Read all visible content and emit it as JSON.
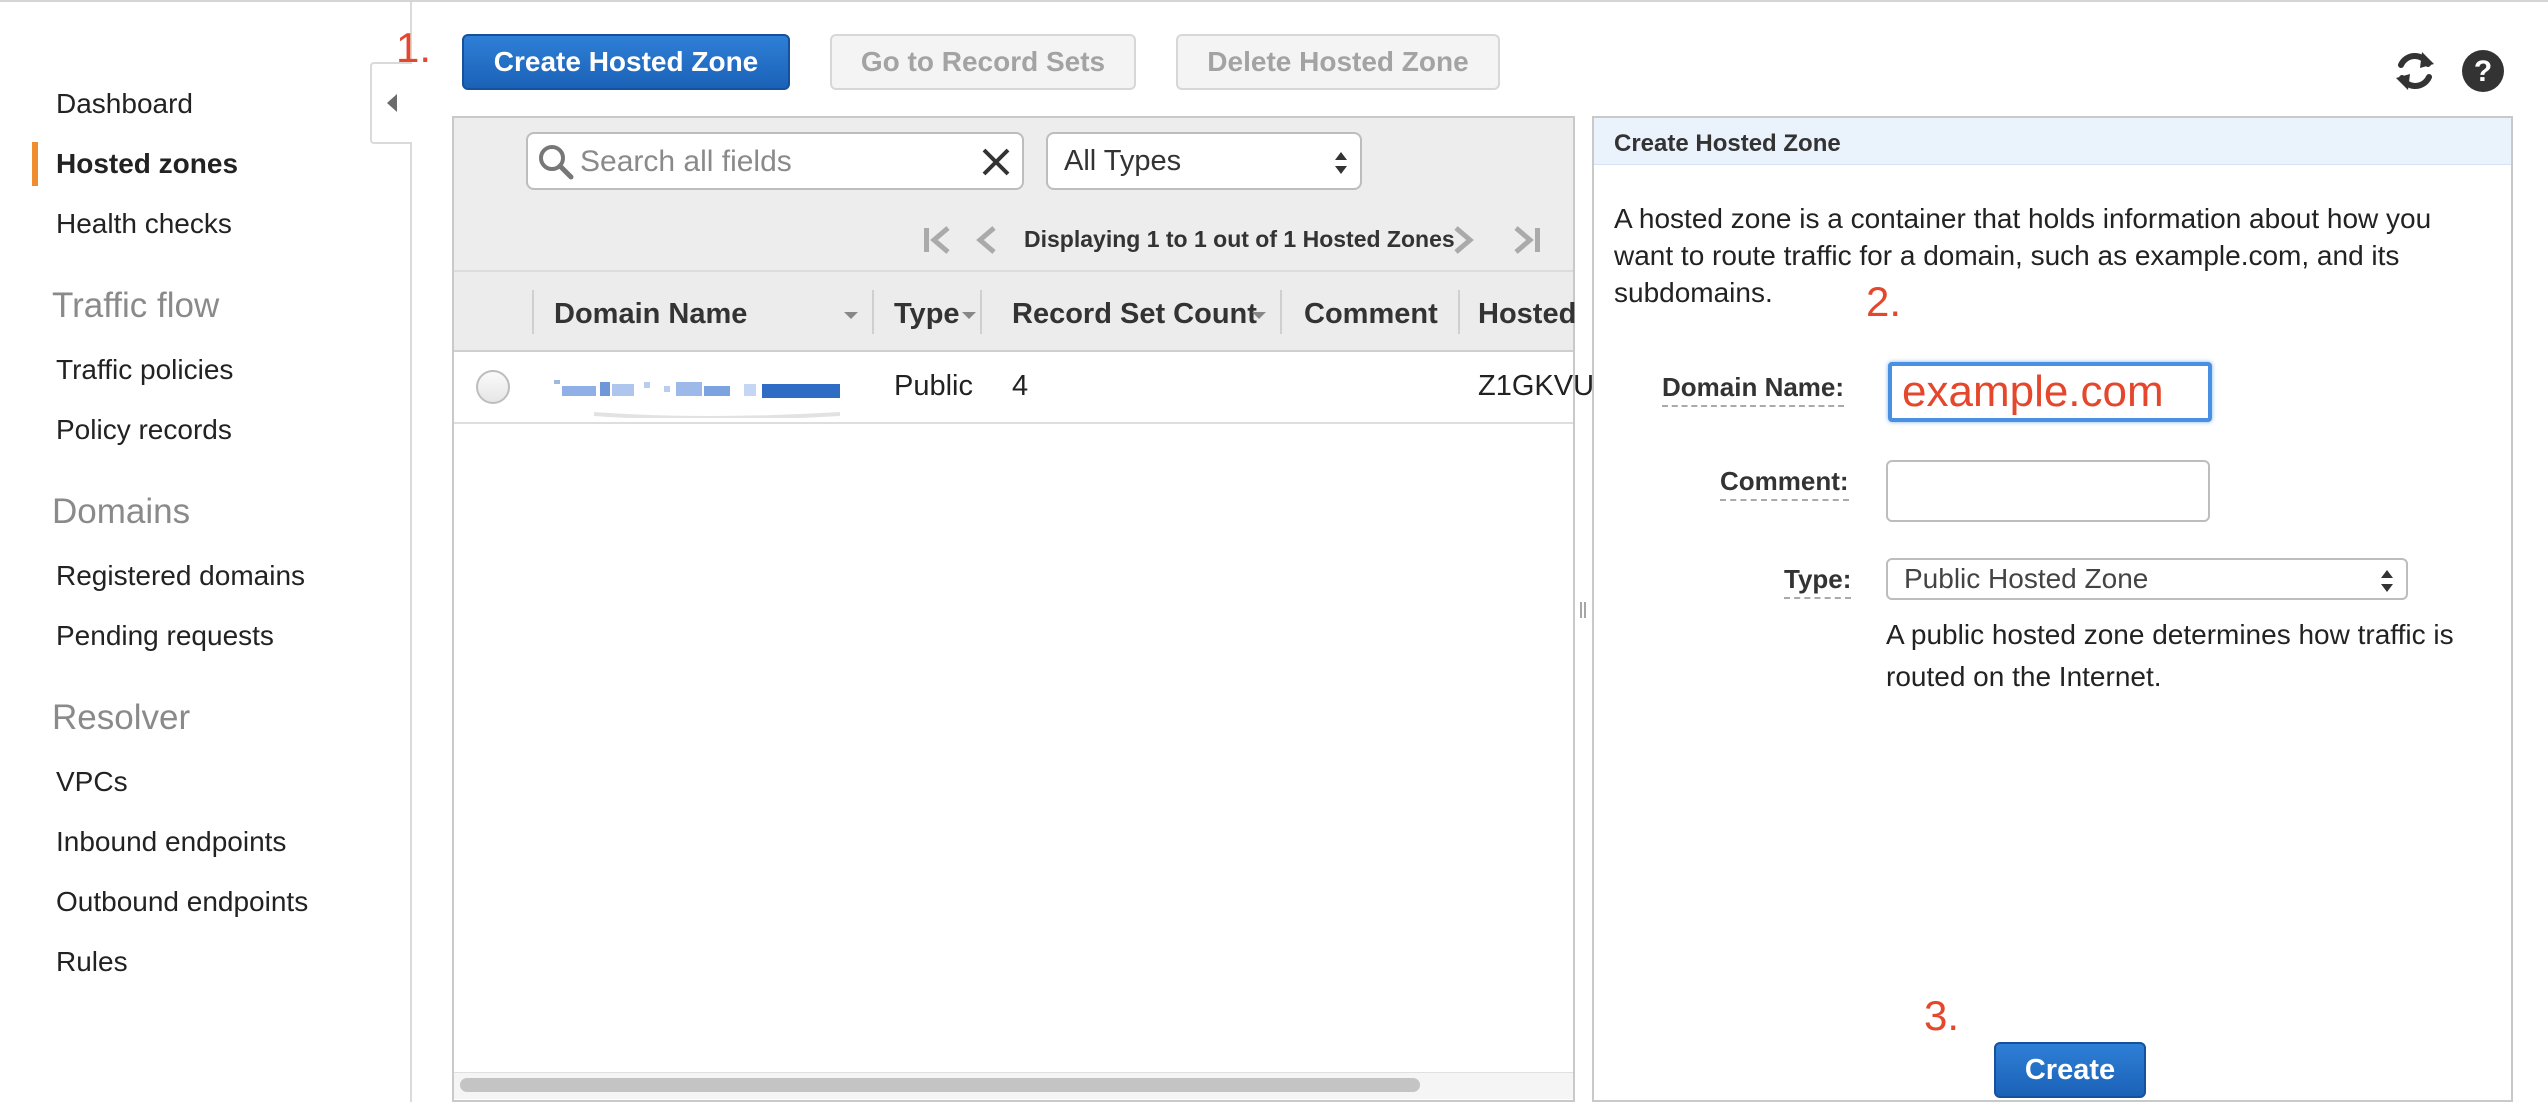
{
  "sidebar": {
    "items_top": [
      {
        "label": "Dashboard"
      },
      {
        "label": "Hosted zones"
      },
      {
        "label": "Health checks"
      }
    ],
    "sections": [
      {
        "title": "Traffic flow",
        "items": [
          "Traffic policies",
          "Policy records"
        ]
      },
      {
        "title": "Domains",
        "items": [
          "Registered domains",
          "Pending requests"
        ]
      },
      {
        "title": "Resolver",
        "items": [
          "VPCs",
          "Inbound endpoints",
          "Outbound endpoints",
          "Rules"
        ]
      }
    ],
    "active_item": "Hosted zones",
    "accent_color": "#f08d2e"
  },
  "toolbar": {
    "step1": "1.",
    "create_zone_label": "Create Hosted Zone",
    "record_sets_label": "Go to Record Sets",
    "delete_zone_label": "Delete Hosted Zone",
    "refresh_icon": "refresh-icon",
    "help_icon": "help-icon"
  },
  "table": {
    "search_placeholder": "Search all fields",
    "type_filter": "All Types",
    "pager_text": "Displaying 1 to 1 out of 1 Hosted Zones",
    "columns": [
      "Domain Name",
      "Type",
      "Record Set Count",
      "Comment",
      "Hosted"
    ],
    "rows": [
      {
        "domain": "",
        "type": "Public",
        "record_count": "4",
        "comment": "",
        "hosted_id": "Z1GKVU"
      }
    ]
  },
  "create_panel": {
    "title": "Create Hosted Zone",
    "description": "A hosted zone is a container that holds information about how you want to route traffic for a domain, such as example.com, and its subdomains.",
    "step2": "2.",
    "domain_label": "Domain Name:",
    "domain_value": "example.com",
    "comment_label": "Comment:",
    "comment_value": "",
    "type_label": "Type:",
    "type_value": "Public Hosted Zone",
    "type_help": "A public hosted zone determines how traffic is routed on the Internet.",
    "step3": "3.",
    "create_label": "Create"
  },
  "colors": {
    "primary_button": "#1a62b8",
    "annotation": "#e4472c",
    "focus_ring": "#4a90e2"
  }
}
